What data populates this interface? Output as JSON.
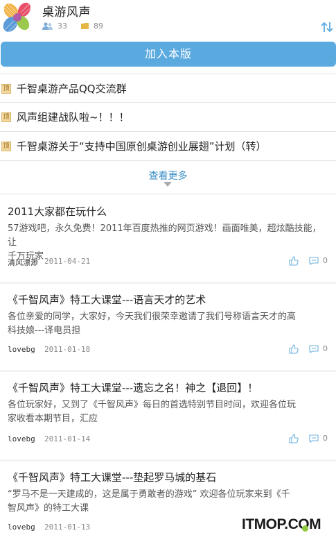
{
  "header": {
    "title": "桌游风声",
    "members_count": "33",
    "posts_count": "89"
  },
  "join_button": {
    "label": "加入本版"
  },
  "pinned": [
    {
      "badge": "顶",
      "title": "千智桌游产品QQ交流群"
    },
    {
      "badge": "顶",
      "title": "风声组建战队啦~！！！"
    },
    {
      "badge": "顶",
      "title": "千智桌游关于“支持中国原创桌游创业展翅”计划（转）"
    }
  ],
  "more": {
    "label": "查看更多"
  },
  "threads": [
    {
      "title": "2011大家都在玩什么",
      "excerpt_line1": "57游戏吧，永久免费！2011年百度热推的网页游戏！画面唯美，超炫酷技能，让",
      "excerpt_line2": "千万玩家",
      "author": "清风漂渺",
      "date": "2011-04-21",
      "comments": "0"
    },
    {
      "title": "《千智风声》特工大课堂---语言天才的艺术",
      "excerpt_line1": "各位亲爱的同学，大家好，今天我们很荣幸邀请了我们号称语言天才的高",
      "excerpt_line2": "科技娘---译电员担",
      "author": "lovebg",
      "date": "2011-01-18",
      "comments": "0"
    },
    {
      "title": "《千智风声》特工大课堂---遗忘之名！神之【退回】！",
      "excerpt_line1": "各位玩家好，又到了《千智风声》每日的首选特别节目时间，欢迎各位玩",
      "excerpt_line2": "家收看本期节目，汇应",
      "author": "lovebg",
      "date": "2011-01-14",
      "comments": "0"
    },
    {
      "title": "《千智风声》特工大课堂---垫起罗马城的基石",
      "excerpt_line1": "“罗马不是一天建成的，这是属于勇敢者的游戏” 欢迎各位玩家来到《千",
      "excerpt_line2": "智风声》的特工大课",
      "author": "lovebg",
      "date": "2011-01-13",
      "comments": ""
    }
  ],
  "watermark": {
    "text": "ITMOP.COM"
  },
  "colors": {
    "accent": "#5aa9df",
    "link": "#3b8ec7",
    "pin_badge": "#f3d9a0",
    "watermark_dot": "#8dc63f"
  },
  "icons": {
    "members": "people-icon",
    "posts": "folder-icon",
    "sort": "sort-arrows-icon",
    "like": "thumbs-up-icon",
    "comment": "comment-bubble-icon"
  }
}
